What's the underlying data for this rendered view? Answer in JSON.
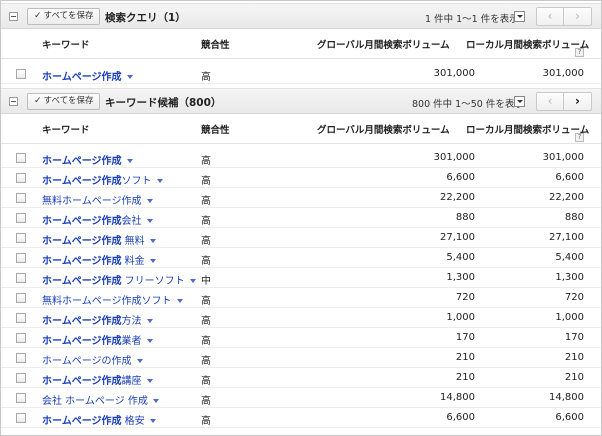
{
  "search_query_section": {
    "save_all_label": "すべてを保存",
    "title": "検索クエリ（1）",
    "pager_text": "1 件中 1～1 件を表示",
    "prev_label": "‹",
    "next_label": "›",
    "columns": {
      "keyword": "キーワード",
      "competition": "競合性",
      "global": "グローバル月間検索ボリューム",
      "local": "ローカル月間検索ボリューム",
      "help": "?"
    },
    "rows": [
      {
        "keyword": "ホームページ作成",
        "competition": "高",
        "global": "301,000",
        "local": "301,000"
      }
    ]
  },
  "keyword_ideas_section": {
    "save_all_label": "すべてを保存",
    "title": "キーワード候補（800）",
    "pager_text": "800 件中 1～50 件を表示",
    "prev_label": "‹",
    "next_label": "›",
    "columns": {
      "keyword": "キーワード",
      "competition": "競合性",
      "global": "グローバル月間検索ボリューム",
      "local": "ローカル月間検索ボリューム",
      "help": "?"
    },
    "rows": [
      {
        "kw_bold": "ホームページ作成",
        "kw_rest": "",
        "competition": "高",
        "global": "301,000",
        "local": "301,000"
      },
      {
        "kw_bold": "ホームページ作成",
        "kw_rest": "ソフト",
        "competition": "高",
        "global": "6,600",
        "local": "6,600"
      },
      {
        "kw_bold": "",
        "kw_rest": "無料ホームページ作成",
        "competition": "高",
        "global": "22,200",
        "local": "22,200"
      },
      {
        "kw_bold": "ホームページ作成",
        "kw_rest": "会社",
        "competition": "高",
        "global": "880",
        "local": "880"
      },
      {
        "kw_bold": "ホームページ作成",
        "kw_rest": " 無料",
        "competition": "高",
        "global": "27,100",
        "local": "27,100"
      },
      {
        "kw_bold": "ホームページ作成",
        "kw_rest": " 料金",
        "competition": "高",
        "global": "5,400",
        "local": "5,400"
      },
      {
        "kw_bold": "ホームページ作成",
        "kw_rest": " フリーソフト",
        "competition": "中",
        "global": "1,300",
        "local": "1,300"
      },
      {
        "kw_bold": "",
        "kw_rest": "無料ホームページ作成ソフト",
        "competition": "高",
        "global": "720",
        "local": "720"
      },
      {
        "kw_bold": "ホームページ作成",
        "kw_rest": "方法",
        "competition": "高",
        "global": "1,000",
        "local": "1,000"
      },
      {
        "kw_bold": "ホームページ作成",
        "kw_rest": "業者",
        "competition": "高",
        "global": "170",
        "local": "170"
      },
      {
        "kw_bold": "",
        "kw_rest": "ホームページの作成",
        "competition": "高",
        "global": "210",
        "local": "210"
      },
      {
        "kw_bold": "ホームページ作成",
        "kw_rest": "講座",
        "competition": "高",
        "global": "210",
        "local": "210"
      },
      {
        "kw_bold": "",
        "kw_rest": "会社 ホームページ 作成",
        "competition": "高",
        "global": "14,800",
        "local": "14,800"
      },
      {
        "kw_bold": "ホームページ作成",
        "kw_rest": " 格安",
        "competition": "高",
        "global": "6,600",
        "local": "6,600"
      }
    ]
  },
  "colors": {
    "keyword_link": "#1a3fb6",
    "header_bar": "#ececec"
  }
}
